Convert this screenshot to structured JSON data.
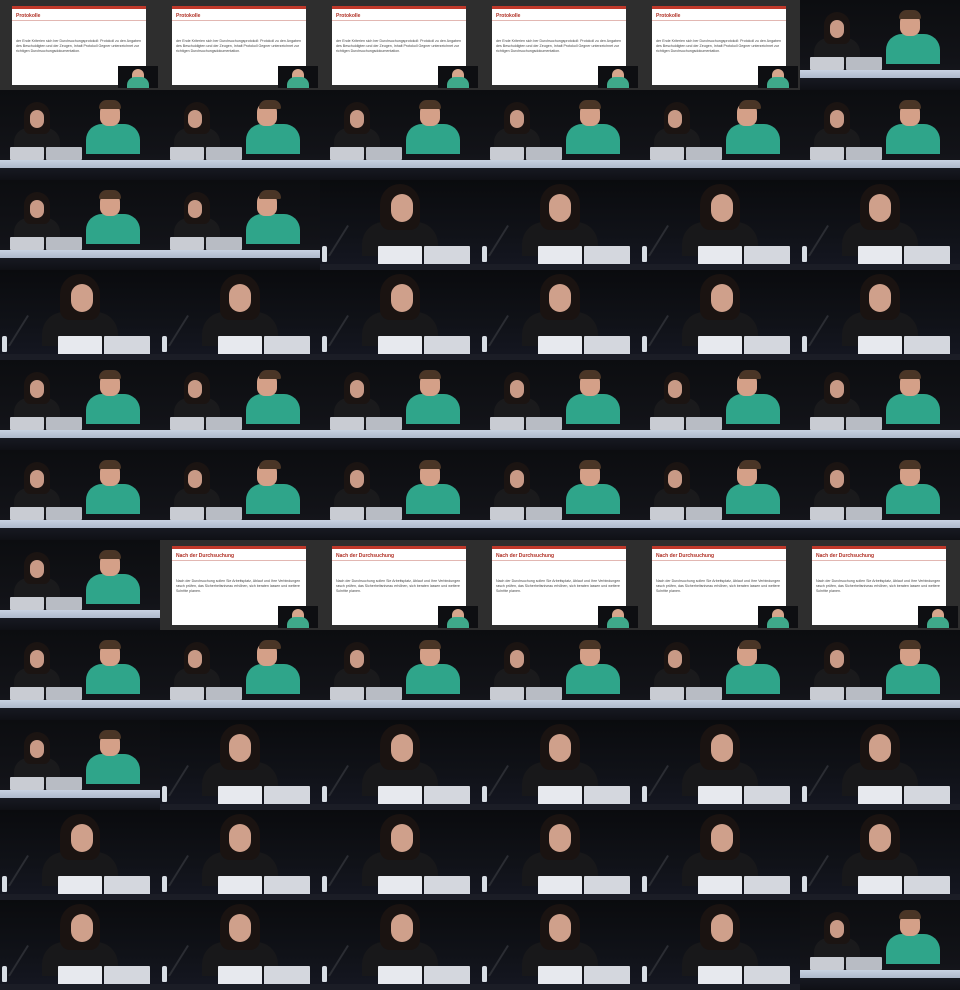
{
  "slides": {
    "protocol": {
      "title": "Protokolle",
      "body": "der Ende Kriterien sich ber Durchsuchungsprotokoll: Protokoll zu den Angaben des Beschuldigten und der Zeugen, Inhalt Protokoll Gegner unterzeichnet zur richtigen Durchsuchungsdokumentation."
    },
    "search": {
      "title": "Nach der Durchsuchung",
      "body": "Nach der Durchsuchung sollen Sie Arbeitsplatz, Ablauf und Ihre Verbindungen rasch prüfen, das Sicherheitsniveau erhöhen, sich beraten lassen und weitere Schritte planen."
    }
  },
  "frames": [
    "protocol",
    "protocol",
    "protocol",
    "protocol",
    "protocol",
    "panel",
    "panel",
    "panel",
    "panel",
    "panel",
    "panel",
    "panel",
    "panel",
    "panel",
    "solo",
    "solo",
    "solo",
    "solo",
    "solo",
    "solo",
    "solo",
    "solo",
    "solo",
    "solo",
    "panel",
    "panel",
    "panel",
    "panel",
    "panel",
    "panel",
    "panel",
    "panel",
    "panel",
    "panel",
    "panel",
    "panel",
    "panel",
    "search",
    "search",
    "search",
    "search",
    "search",
    "panel",
    "panel",
    "panel",
    "panel",
    "panel",
    "panel",
    "panel",
    "solo",
    "solo",
    "solo",
    "solo",
    "solo",
    "solo",
    "solo",
    "solo",
    "solo",
    "solo",
    "solo",
    "solo",
    "solo",
    "solo",
    "solo",
    "solo",
    "panel"
  ],
  "colors": {
    "accent_red": "#c0392b",
    "shirt_green": "#2fa58a",
    "desk_blue": "#c8d2e2"
  }
}
